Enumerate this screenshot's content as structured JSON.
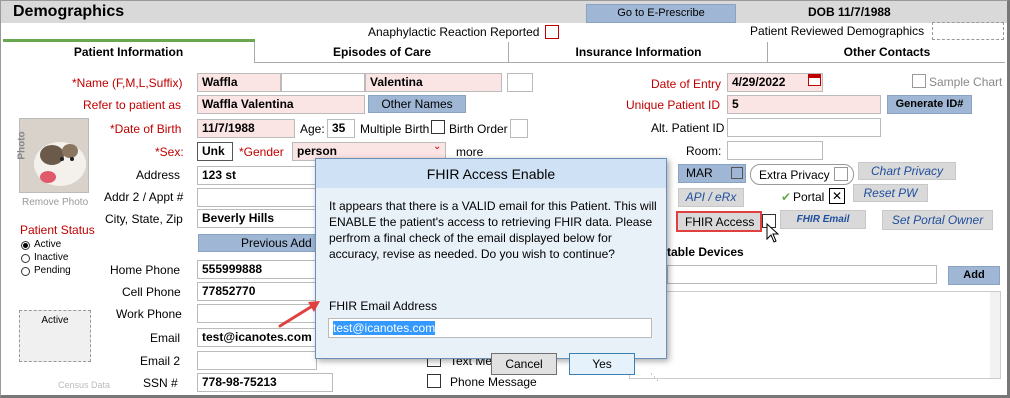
{
  "header": {
    "title": "Demographics",
    "eprescribe_label": "Go to E-Prescribe",
    "dob_text": "DOB 11/7/1988",
    "anaphylactic_label": "Anaphylactic Reaction Reported",
    "reviewed_label": "Patient Reviewed Demographics"
  },
  "tabs": [
    {
      "label": "Patient Information"
    },
    {
      "label": "Episodes of Care"
    },
    {
      "label": "Insurance Information"
    },
    {
      "label": "Other Contacts"
    }
  ],
  "form": {
    "name_label": "*Name (F,M,L,Suffix)",
    "first_name": "Waffla",
    "middle_name": "",
    "last_name": "Valentina",
    "refer_label": "Refer to patient as",
    "refer_value": "Waffla Valentina",
    "other_names_label": "Other Names",
    "dob_label": "*Date of Birth",
    "dob_value": "11/7/1988",
    "age_label": "Age:",
    "age_value": "35",
    "multiple_birth_label": "Multiple Birth",
    "birth_order_label": "Birth Order",
    "sex_label": "*Sex:",
    "sex_value": "Unk",
    "gender_label": "*Gender",
    "gender_value": "person",
    "more_label": "more",
    "address_label": "Address",
    "address_value": "123 st",
    "addr2_label": "Addr 2 / Appt #",
    "city_label": "City, State, Zip",
    "city_value": "Beverly Hills",
    "previous_addr_label": "Previous Add",
    "home_phone_label": "Home Phone",
    "home_phone_value": "555999888",
    "cell_phone_label": "Cell Phone",
    "cell_phone_value": "77852770",
    "work_phone_label": "Work Phone",
    "email_label": "Email",
    "email_value": "test@icanotes.com",
    "email2_label": "Email 2",
    "ssn_label": "SSN #",
    "ssn_value": "778-98-75213",
    "text_message_label": "Text Message",
    "phone_message_label": "Phone Message",
    "photo_label": "Photo",
    "remove_photo_label": "Remove Photo",
    "status_label": "Patient Status",
    "status_options": [
      "Active",
      "Inactive",
      "Pending"
    ],
    "status_box_label": "Active",
    "census_label": "Census Data"
  },
  "right": {
    "sample_chart_label": "Sample Chart",
    "date_entry_label": "Date of Entry",
    "date_entry_value": "4/29/2022",
    "unique_id_label": "Unique Patient ID",
    "unique_id_value": "5",
    "generate_label": "Generate ID#",
    "alt_id_label": "Alt. Patient ID",
    "room_label": "Room:",
    "mar_label": "MAR",
    "extra_privacy_label": "Extra Privacy",
    "chart_privacy_label": "Chart Privacy",
    "api_label": "API / eRx",
    "portal_label": "Portal",
    "reset_pw_label": "Reset PW",
    "fhir_access_label": "FHIR Access",
    "fhir_email_label": "FHIR Email",
    "portal_owner_label": "Set Portal Owner",
    "devices_label": "table Devices",
    "add_label": "Add"
  },
  "dialog": {
    "title": "FHIR Access Enable",
    "message": "It appears that there is a VALID email for this Patient. This will ENABLE the patient's access to retrieving FHIR data.  Please perfrom a final check of the email displayed below for accuracy, revise as needed. Do you wish to continue?",
    "field_label": "FHIR Email Address",
    "field_value": "test@icanotes.com",
    "cancel_label": "Cancel",
    "yes_label": "Yes"
  },
  "colors": {
    "accent_blue": "#9fb7d4",
    "required_red": "#c00000",
    "link_blue": "#1f4e9c",
    "annotation_red": "#e04040"
  }
}
